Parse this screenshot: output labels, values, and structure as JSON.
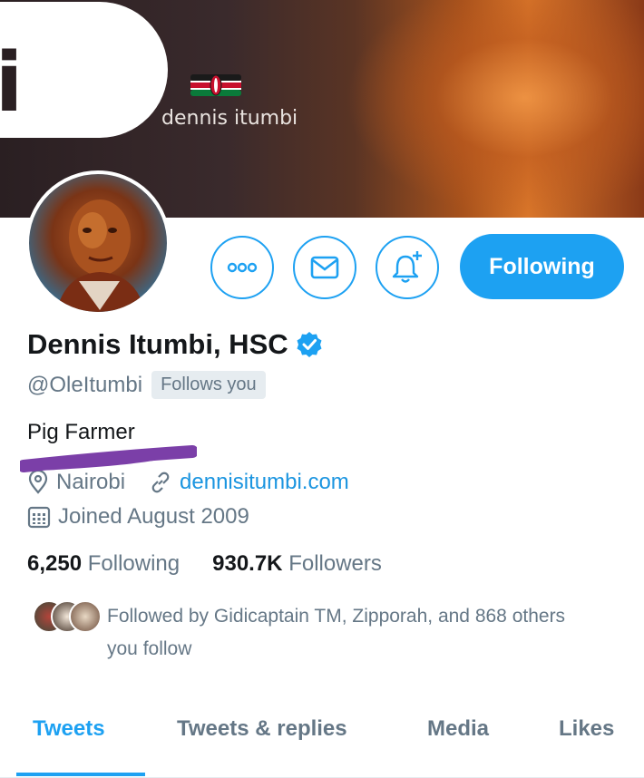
{
  "banner": {
    "name": "dennis itumbi",
    "logo_letter": "i"
  },
  "profile": {
    "display_name": "Dennis Itumbi, HSC",
    "verified": true,
    "handle": "@OleItumbi",
    "follows_you_label": "Follows you",
    "bio": "Pig Farmer",
    "location": "Nairobi",
    "website": "dennisitumbi.com",
    "joined": "Joined August 2009"
  },
  "actions": {
    "more_icon": "more-icon",
    "message_icon": "envelope-icon",
    "notify_icon": "bell-plus-icon",
    "follow_label": "Following"
  },
  "stats": {
    "following_count": "6,250",
    "following_label": "Following",
    "followers_count": "930.7K",
    "followers_label": "Followers"
  },
  "followed_by": {
    "text": "Followed by Gidicaptain TM, Zipporah, and 868 others you follow"
  },
  "tabs": [
    {
      "label": "Tweets",
      "active": true
    },
    {
      "label": "Tweets & replies",
      "active": false
    },
    {
      "label": "Media",
      "active": false
    },
    {
      "label": "Likes",
      "active": false
    }
  ],
  "colors": {
    "accent": "#1da1f2",
    "secondary_text": "#657786",
    "primary_text": "#14171a"
  }
}
